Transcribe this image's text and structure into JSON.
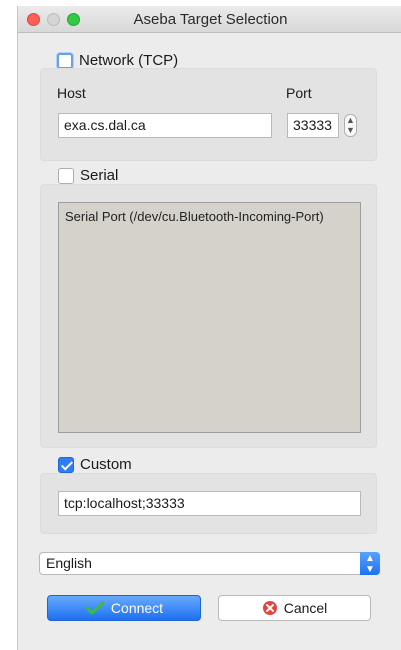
{
  "window": {
    "title": "Aseba Target Selection"
  },
  "network": {
    "label": "Network (TCP)",
    "checked": false,
    "host_label": "Host",
    "port_label": "Port",
    "host_value": "exa.cs.dal.ca",
    "port_value": "33333"
  },
  "serial": {
    "label": "Serial",
    "checked": false,
    "ports": [
      "Serial Port (/dev/cu.Bluetooth-Incoming-Port)"
    ]
  },
  "custom": {
    "label": "Custom",
    "checked": true,
    "value": "tcp:localhost;33333"
  },
  "language": {
    "selected": "English"
  },
  "buttons": {
    "connect": "Connect",
    "cancel": "Cancel"
  },
  "colors": {
    "accent": "#2f7cf6",
    "cancel_icon": "#e8423b",
    "connect_icon": "#3bbd3b"
  },
  "icons": {
    "connect": "checkmark-icon",
    "cancel": "close-circle-icon"
  }
}
